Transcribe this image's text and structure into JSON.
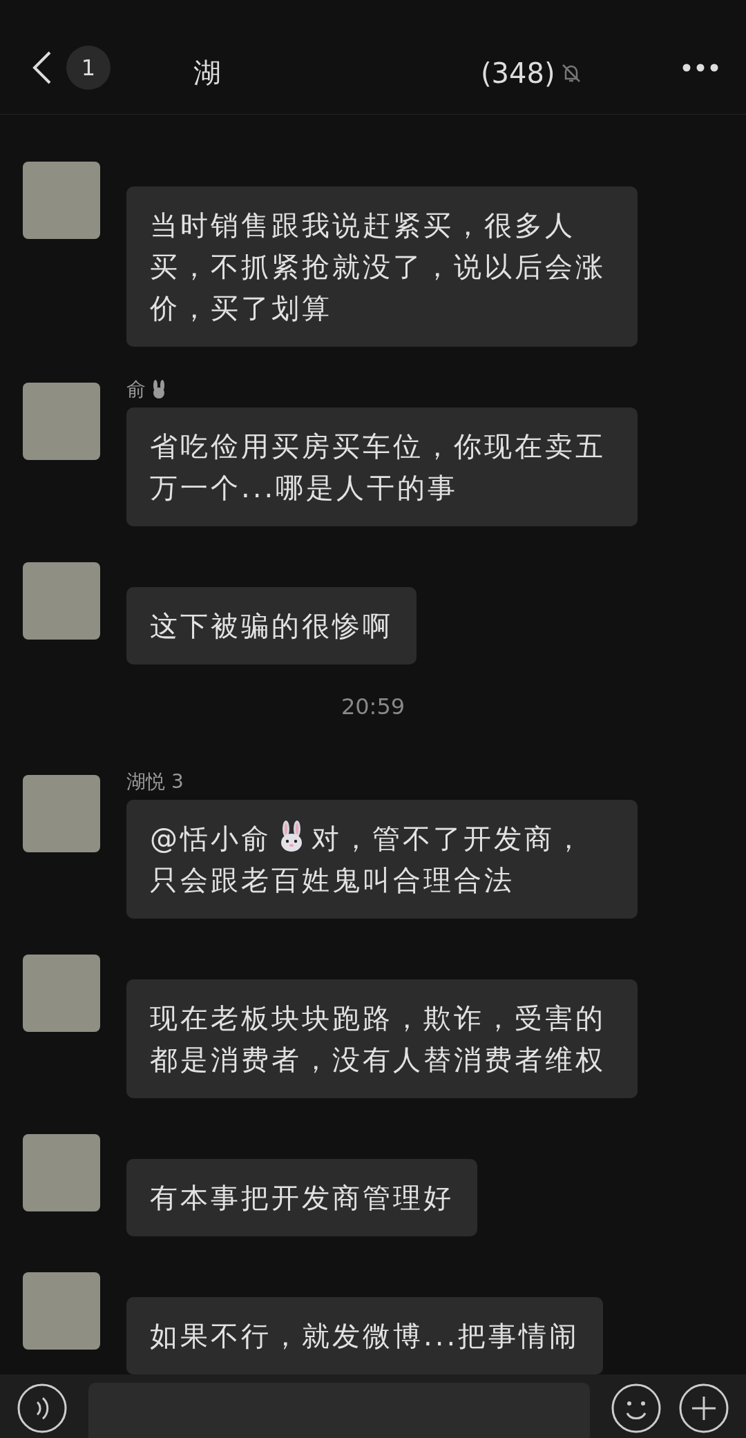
{
  "header": {
    "unread": "1",
    "title_start": "湖",
    "member_count": "(348)",
    "muted": true
  },
  "messages": [
    {
      "kind": "msg",
      "text": "当时销售跟我说赶紧买，很多人买，不抓紧抢就没了，说以后会涨价，买了划算"
    },
    {
      "kind": "msg",
      "name": "俞",
      "name_emoji": true,
      "text": "省吃俭用买房买车位，你现在卖五万一个...哪是人干的事"
    },
    {
      "kind": "msg",
      "text": "这下被骗的很惨啊"
    },
    {
      "kind": "time",
      "text": "20:59"
    },
    {
      "kind": "msg",
      "name": "湖悦 3",
      "parts": [
        {
          "kind": "text",
          "text": "@恬小俞"
        },
        {
          "kind": "emoji"
        },
        {
          "kind": "text",
          "text": "对，管不了开发商，只会跟老百姓鬼叫合理合法"
        }
      ]
    },
    {
      "kind": "msg",
      "text": " 现在老板块块跑路，欺诈，受害的都是消费者，没有人替消费者维权"
    },
    {
      "kind": "msg",
      "text": "有本事把开发商管理好"
    },
    {
      "kind": "msg",
      "text": "如果不行，就发微博...把事情闹"
    }
  ]
}
